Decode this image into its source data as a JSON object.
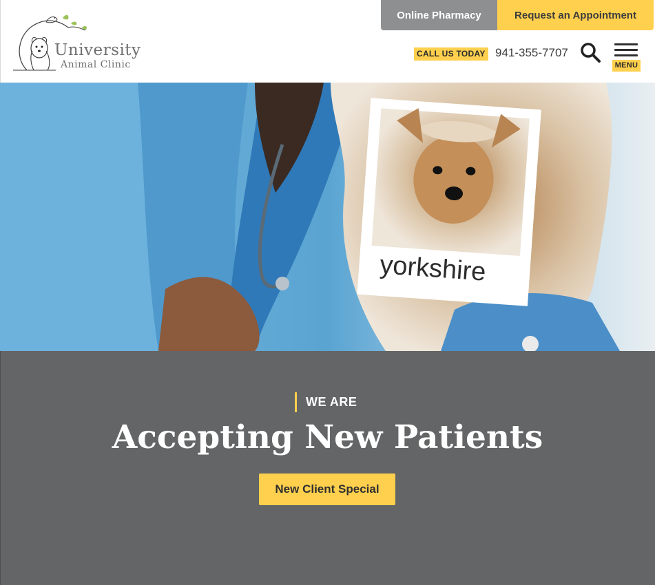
{
  "brand": {
    "name_line1": "University",
    "name_line2": "Animal Clinic"
  },
  "header": {
    "pharmacy_label": "Online Pharmacy",
    "appointment_label": "Request an Appointment",
    "call_label": "CALL US TODAY",
    "phone": "941-355-7707",
    "search_icon": "search-icon",
    "menu_icon": "hamburger-icon",
    "menu_label": "MENU"
  },
  "hero": {
    "polaroid_caption": "yorkshire"
  },
  "band": {
    "eyebrow": "WE ARE",
    "headline": "Accepting New Patients",
    "cta_label": "New Client Special"
  },
  "colors": {
    "accent_yellow": "#ffd04d",
    "pharmacy_gray": "#8e8f91",
    "band_gray": "#646566",
    "text_dark": "#3d3d3d"
  }
}
